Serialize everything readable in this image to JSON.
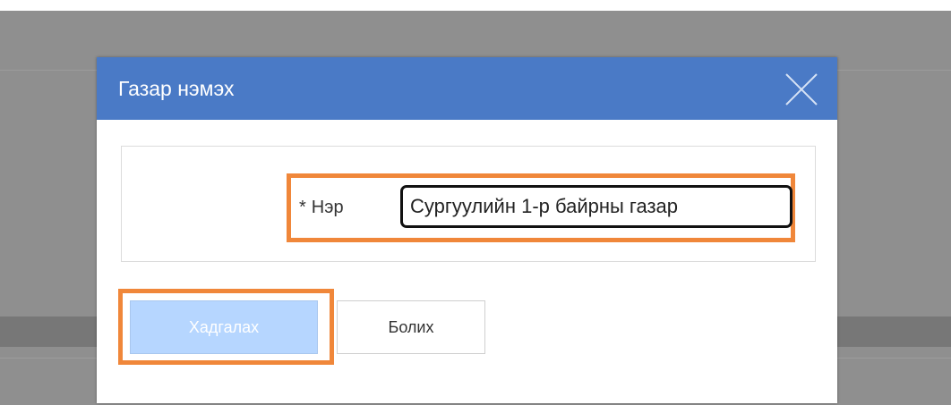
{
  "dialog": {
    "title": "Газар нэмэх",
    "close_icon": "close-icon",
    "header_color": "#4a7ac6"
  },
  "form": {
    "required_marker": "*",
    "name_label": "Нэр",
    "name_value": "Сургуулийн 1-р байрны газар"
  },
  "actions": {
    "save_label": "Хадгалах",
    "cancel_label": "Болих"
  },
  "highlight_color": "#f0873a"
}
